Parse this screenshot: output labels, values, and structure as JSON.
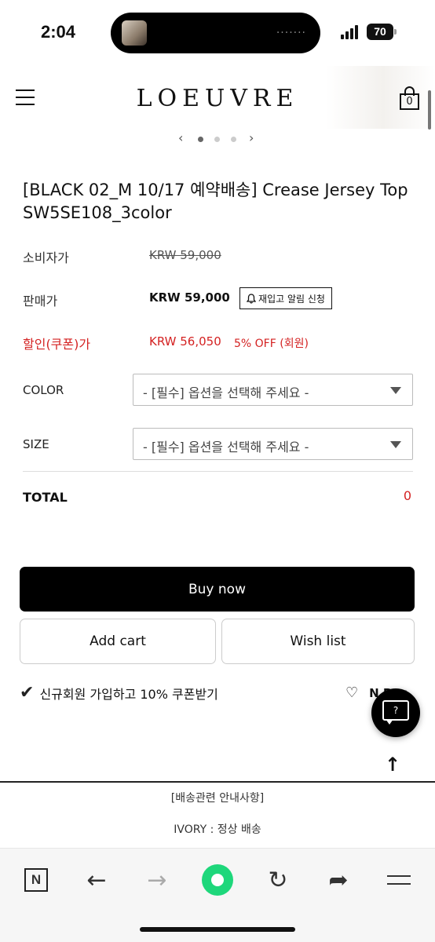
{
  "status": {
    "time": "2:04",
    "battery": "70",
    "island_dots": "·······"
  },
  "header": {
    "logo": "LOEUVRE",
    "cart_count": "0"
  },
  "carousel": {
    "prev": "‹",
    "next": "›",
    "dots": 3,
    "active_dot": 0
  },
  "product": {
    "title": "[BLACK 02_M 10/17 예약배송] Crease Jersey Top SW5SE108_3color",
    "consumer_price_label": "소비자가",
    "consumer_price": "KRW 59,000",
    "sale_price_label": "판매가",
    "sale_price": "KRW 59,000",
    "restock_label": "재입고 알림 신청",
    "coupon_price_label": "할인(쿠폰)가",
    "coupon_price": "KRW 56,050",
    "coupon_note": "5% OFF (회원)"
  },
  "options": {
    "color_label": "COLOR",
    "color_value": "- [필수] 옵션을 선택해 주세요 -",
    "size_label": "SIZE",
    "size_value": "- [필수] 옵션을 선택해 주세요 -"
  },
  "total": {
    "label": "TOTAL",
    "value": "0"
  },
  "buttons": {
    "buy": "Buy now",
    "cart": "Add cart",
    "wish": "Wish list"
  },
  "promo": {
    "check": "✔",
    "text": "신규회원 가입하고 10% 쿠폰받기",
    "npay": "N Pay"
  },
  "chat": {
    "label": "?"
  },
  "notice": {
    "line1": "[배송관련 안내사항]",
    "line2": "IVORY : 정상 배송"
  },
  "toolbar": {
    "n_label": "N",
    "back": "←",
    "forward": "→",
    "reload": "↻",
    "share": "➦"
  },
  "colors": {
    "accent_red": "#d42222",
    "toolbar_green": "#1ed77b"
  }
}
